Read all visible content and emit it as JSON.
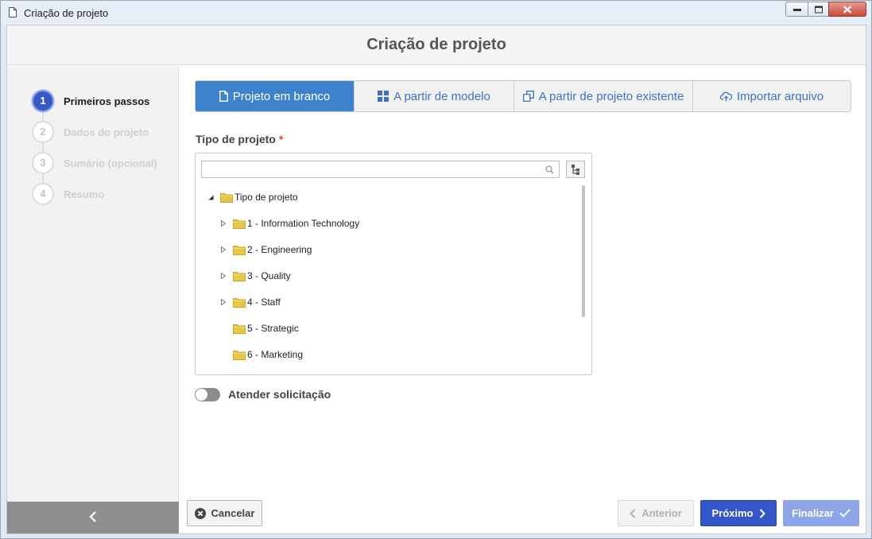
{
  "window": {
    "title": "Criação de projeto"
  },
  "dialog": {
    "title": "Criação de projeto"
  },
  "steps": [
    {
      "num": "1",
      "label": "Primeiros passos",
      "active": true
    },
    {
      "num": "2",
      "label": "Dados do projeto",
      "active": false
    },
    {
      "num": "3",
      "label": "Sumário (opcional)",
      "active": false
    },
    {
      "num": "4",
      "label": "Resumo",
      "active": false
    }
  ],
  "tabs": [
    {
      "label": "Projeto em branco",
      "icon": "file-icon",
      "active": true
    },
    {
      "label": "A partir de modelo",
      "icon": "grid-icon",
      "active": false
    },
    {
      "label": "A partir de projeto existente",
      "icon": "copy-icon",
      "active": false
    },
    {
      "label": "Importar arquivo",
      "icon": "cloud-upload-icon",
      "active": false
    }
  ],
  "project_type": {
    "label": "Tipo de projeto",
    "required_marker": "*",
    "search_placeholder": "",
    "tree": {
      "root": "Tipo de projeto",
      "children": [
        {
          "label": "1 - Information Technology",
          "expandable": true
        },
        {
          "label": "2 - Engineering",
          "expandable": true
        },
        {
          "label": "3 - Quality",
          "expandable": true
        },
        {
          "label": "4 - Staff",
          "expandable": true
        },
        {
          "label": "5 - Strategic",
          "expandable": false
        },
        {
          "label": "6 - Marketing",
          "expandable": false
        }
      ]
    }
  },
  "toggle": {
    "label": "Atender solicitação",
    "on": false
  },
  "footer": {
    "cancel": "Cancelar",
    "previous": "Anterior",
    "next": "Próximo",
    "finish": "Finalizar"
  },
  "colors": {
    "primary": "#3457c8",
    "tab_active": "#3d83cc",
    "link": "#3f72be",
    "folder": "#e8c64a",
    "required": "#e04848"
  }
}
